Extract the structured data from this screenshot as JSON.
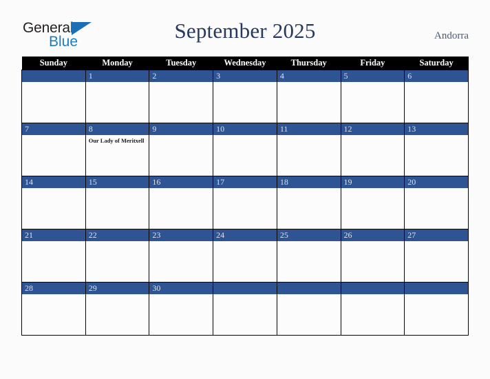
{
  "logo": {
    "word_top": "General",
    "word_bottom": "Blue",
    "triangle_color": "#1a6fb5",
    "blue_color": "#1a7cc4",
    "dark_color": "#231f20"
  },
  "header": {
    "title": "September 2025",
    "country": "Andorra",
    "title_color": "#27395f",
    "country_color": "#4a5a80"
  },
  "calendar": {
    "accent_blue": "#2e5494",
    "header_background": "#000000",
    "weekdays": [
      "Sunday",
      "Monday",
      "Tuesday",
      "Wednesday",
      "Thursday",
      "Friday",
      "Saturday"
    ],
    "weeks": [
      [
        {
          "day": "",
          "events": []
        },
        {
          "day": "1",
          "events": []
        },
        {
          "day": "2",
          "events": []
        },
        {
          "day": "3",
          "events": []
        },
        {
          "day": "4",
          "events": []
        },
        {
          "day": "5",
          "events": []
        },
        {
          "day": "6",
          "events": []
        }
      ],
      [
        {
          "day": "7",
          "events": []
        },
        {
          "day": "8",
          "events": [
            "Our Lady of Meritxell"
          ]
        },
        {
          "day": "9",
          "events": []
        },
        {
          "day": "10",
          "events": []
        },
        {
          "day": "11",
          "events": []
        },
        {
          "day": "12",
          "events": []
        },
        {
          "day": "13",
          "events": []
        }
      ],
      [
        {
          "day": "14",
          "events": []
        },
        {
          "day": "15",
          "events": []
        },
        {
          "day": "16",
          "events": []
        },
        {
          "day": "17",
          "events": []
        },
        {
          "day": "18",
          "events": []
        },
        {
          "day": "19",
          "events": []
        },
        {
          "day": "20",
          "events": []
        }
      ],
      [
        {
          "day": "21",
          "events": []
        },
        {
          "day": "22",
          "events": []
        },
        {
          "day": "23",
          "events": []
        },
        {
          "day": "24",
          "events": []
        },
        {
          "day": "25",
          "events": []
        },
        {
          "day": "26",
          "events": []
        },
        {
          "day": "27",
          "events": []
        }
      ],
      [
        {
          "day": "28",
          "events": []
        },
        {
          "day": "29",
          "events": []
        },
        {
          "day": "30",
          "events": []
        },
        {
          "day": "",
          "events": []
        },
        {
          "day": "",
          "events": []
        },
        {
          "day": "",
          "events": []
        },
        {
          "day": "",
          "events": []
        }
      ]
    ]
  }
}
